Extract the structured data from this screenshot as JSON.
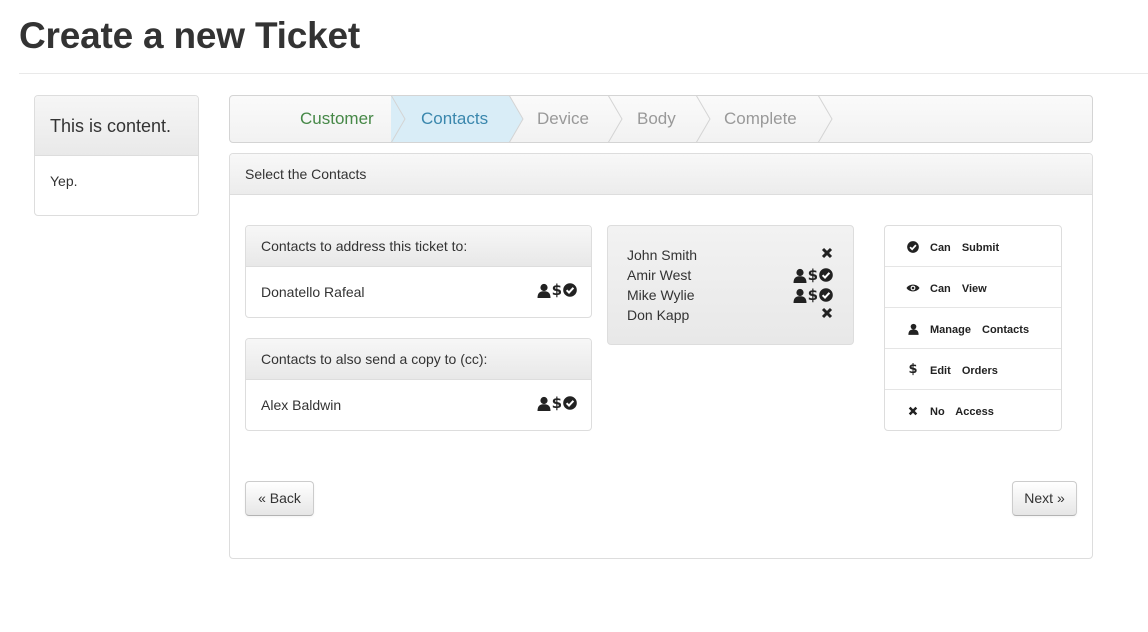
{
  "page": {
    "title": "Create a new Ticket"
  },
  "sidebar": {
    "heading": "This is content.",
    "body": "Yep."
  },
  "wizard": {
    "steps": [
      {
        "label": "Customer",
        "state": "done"
      },
      {
        "label": "Contacts",
        "state": "active"
      },
      {
        "label": "Device",
        "state": "pending"
      },
      {
        "label": "Body",
        "state": "pending"
      },
      {
        "label": "Complete",
        "state": "pending"
      }
    ]
  },
  "panel": {
    "heading": "Select the Contacts",
    "to_box": {
      "heading": "Contacts to address this ticket to:",
      "contacts": [
        {
          "name": "Donatello Rafeal",
          "icons": [
            "user-icon",
            "dollar-icon",
            "check-circle-icon"
          ]
        }
      ]
    },
    "cc_box": {
      "heading": "Contacts to also send a copy to (cc):",
      "contacts": [
        {
          "name": "Alex Baldwin",
          "icons": [
            "user-icon",
            "dollar-icon",
            "check-circle-icon"
          ]
        }
      ]
    },
    "available": [
      {
        "name": "John Smith",
        "icons": [
          "times-icon"
        ]
      },
      {
        "name": "Amir West",
        "icons": [
          "user-icon",
          "dollar-icon",
          "check-circle-icon"
        ]
      },
      {
        "name": "Mike Wylie",
        "icons": [
          "user-icon",
          "dollar-icon",
          "check-circle-icon"
        ]
      },
      {
        "name": "Don Kapp",
        "icons": [
          "times-icon"
        ]
      }
    ],
    "legend": [
      {
        "icon": "check-circle-icon",
        "label": "Can Submit"
      },
      {
        "icon": "eye-icon",
        "label": "Can View"
      },
      {
        "icon": "user-icon",
        "label": "Manage Contacts"
      },
      {
        "icon": "dollar-icon",
        "label": "Edit Orders"
      },
      {
        "icon": "times-icon",
        "label": "No Access"
      }
    ],
    "back_label": "« Back",
    "next_label": "Next »"
  },
  "colors": {
    "step_done": "#468847",
    "step_active": "#3a87ad",
    "step_active_bg": "#d9edf7",
    "step_pending": "#999999"
  }
}
